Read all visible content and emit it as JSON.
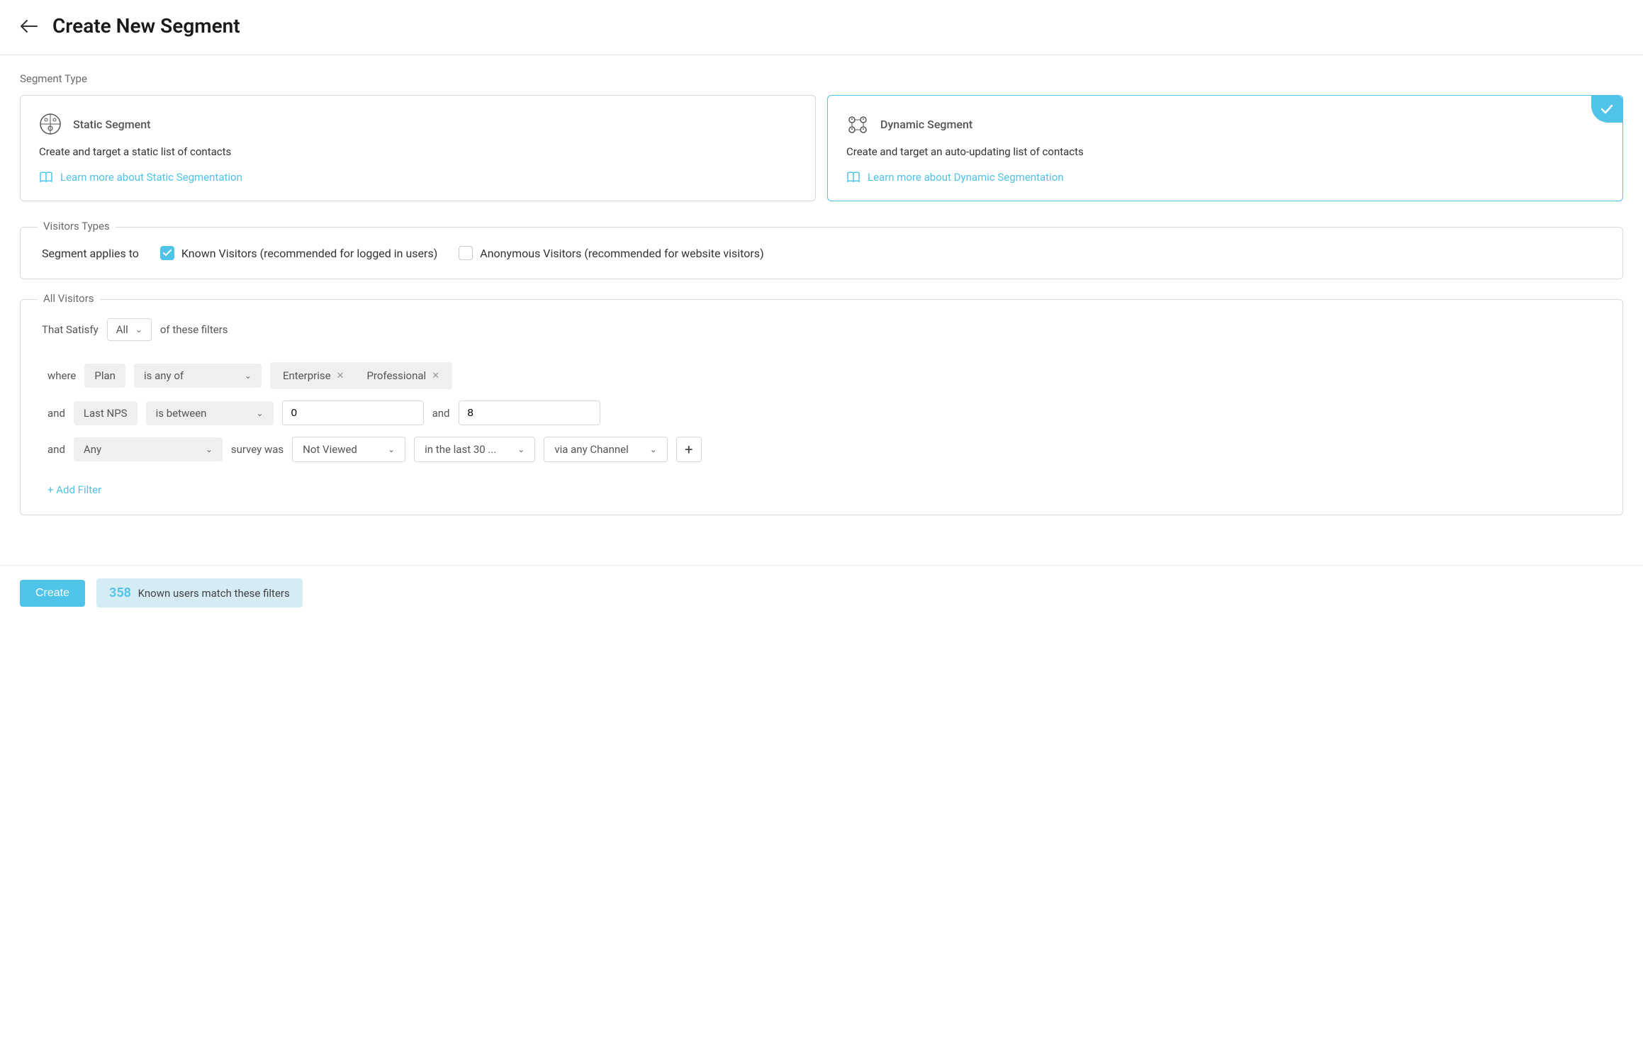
{
  "header": {
    "title": "Create New Segment"
  },
  "segment_type": {
    "label": "Segment Type",
    "static": {
      "title": "Static Segment",
      "desc": "Create and target a static list of contacts",
      "link": "Learn more about Static Segmentation"
    },
    "dynamic": {
      "title": "Dynamic Segment",
      "desc": "Create and target an auto-updating list of contacts",
      "link": "Learn more about Dynamic Segmentation"
    }
  },
  "visitors": {
    "legend": "Visitors Types",
    "applies_label": "Segment applies to",
    "known": "Known Visitors (recommended for logged in users)",
    "anonymous": "Anonymous Visitors (recommended for website visitors)"
  },
  "filters": {
    "legend": "All Visitors",
    "satisfy_pre": "That Satisfy",
    "satisfy_select": "All",
    "satisfy_post": "of these filters",
    "row1": {
      "where": "where",
      "attr": "Plan",
      "op": "is any of",
      "val1": "Enterprise",
      "val2": "Professional"
    },
    "row2": {
      "and": "and",
      "attr": "Last NPS",
      "op": "is between",
      "val1": "0",
      "and2": "and",
      "val2": "8"
    },
    "row3": {
      "and": "and",
      "attr": "Any",
      "mid": "survey was",
      "op": "Not Viewed",
      "time": "in the last 30 ...",
      "channel": "via any Channel"
    },
    "add": "+ Add Filter"
  },
  "footer": {
    "create": "Create",
    "count": "358",
    "match_text": "Known users match these filters"
  }
}
